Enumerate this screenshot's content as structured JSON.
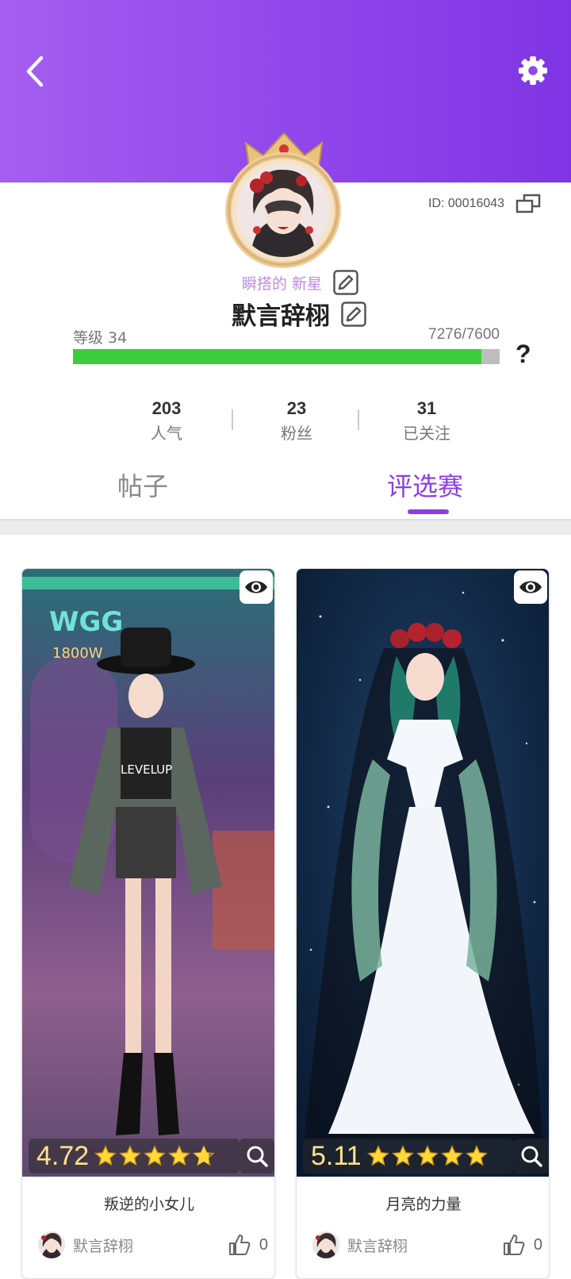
{
  "header": {
    "back_icon": "chevron-left-icon",
    "settings_icon": "gear-icon"
  },
  "profile": {
    "id_label": "ID: 00016043",
    "subtitle": "瞬搭的 新星",
    "name": "默言辞栩",
    "level_label": "等级 34",
    "exp_label": "7276/7600",
    "exp_progress": 0.957,
    "help_label": "?"
  },
  "stats": [
    {
      "value": "203",
      "label": "人气"
    },
    {
      "value": "23",
      "label": "粉丝"
    },
    {
      "value": "31",
      "label": "已关注"
    }
  ],
  "tabs": [
    {
      "label": "帖子",
      "active": false
    },
    {
      "label": "评选赛",
      "active": true
    }
  ],
  "entries": [
    {
      "rating": "4.72",
      "stars": 4.72,
      "title": "叛逆的小女儿",
      "author": "默言辞栩",
      "likes": "0",
      "image_text": [
        "WGG",
        "1800W",
        "LEVELUP"
      ]
    },
    {
      "rating": "5.11",
      "stars": 5,
      "title": "月亮的力量",
      "author": "默言辞栩",
      "likes": "0"
    }
  ],
  "colors": {
    "accent": "#8a3fe0",
    "header_start": "#a55ef0",
    "header_end": "#7f35e4",
    "progress": "#3ccd3c",
    "rating": "#ffe38a"
  }
}
